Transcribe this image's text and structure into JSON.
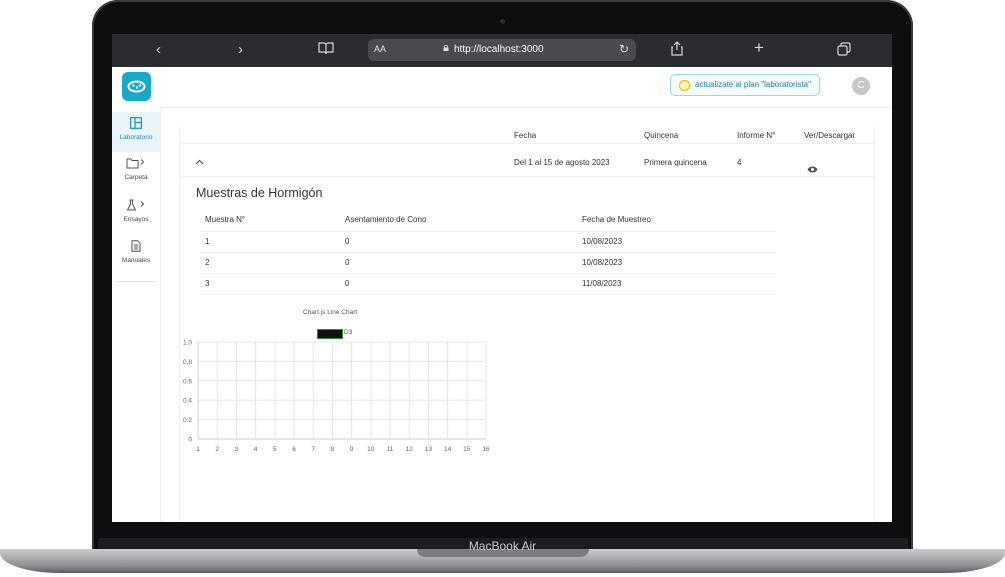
{
  "device": {
    "label": "MacBook Air"
  },
  "browser": {
    "text_size_label": "AA",
    "url": "http://localhost:3000",
    "icons": [
      "back-icon",
      "forward-icon",
      "bookmarks-icon",
      "reload-icon",
      "share-icon",
      "new-tab-icon",
      "tabs-icon"
    ]
  },
  "sidebar": {
    "items": [
      {
        "label": "Laboratorio",
        "icon": "layout-icon"
      },
      {
        "label": "Carpeta",
        "icon": "folder-icon"
      },
      {
        "label": "Ensayos",
        "icon": "flask-icon"
      },
      {
        "label": "Manuales",
        "icon": "document-icon"
      }
    ]
  },
  "topbar": {
    "upgrade_label": "actualizate al plan \"laboratorista\"",
    "avatar_initial": "C"
  },
  "report_table": {
    "headers": [
      "Fecha",
      "Quincena",
      "Informe N°",
      "Ver/Descargar"
    ],
    "row": {
      "fecha": "Del 1 al 15 de agosto 2023",
      "quincena": "Primera quincena",
      "informe": "4"
    }
  },
  "samples": {
    "title": "Muestras de Hormigón",
    "headers": [
      "Muestra N°",
      "Asentamiento de Cono",
      "Fecha de Muestreo"
    ],
    "rows": [
      [
        "1",
        "0",
        "10/08/2023"
      ],
      [
        "2",
        "0",
        "10/08/2023"
      ],
      [
        "3",
        "0",
        "11/08/2023"
      ]
    ]
  },
  "chart_data": {
    "type": "line",
    "title": "Chart.js Line Chart",
    "series": [
      {
        "name": "D3",
        "values": []
      }
    ],
    "x": [
      1,
      2,
      3,
      4,
      5,
      6,
      7,
      8,
      9,
      10,
      11,
      12,
      13,
      14,
      15,
      16
    ],
    "y_ticks": [
      "0",
      "0.2",
      "0.4",
      "0.6",
      "0.8",
      "1.0"
    ],
    "ylim": [
      0,
      1.0
    ],
    "grid": true,
    "legend_position": "top"
  }
}
